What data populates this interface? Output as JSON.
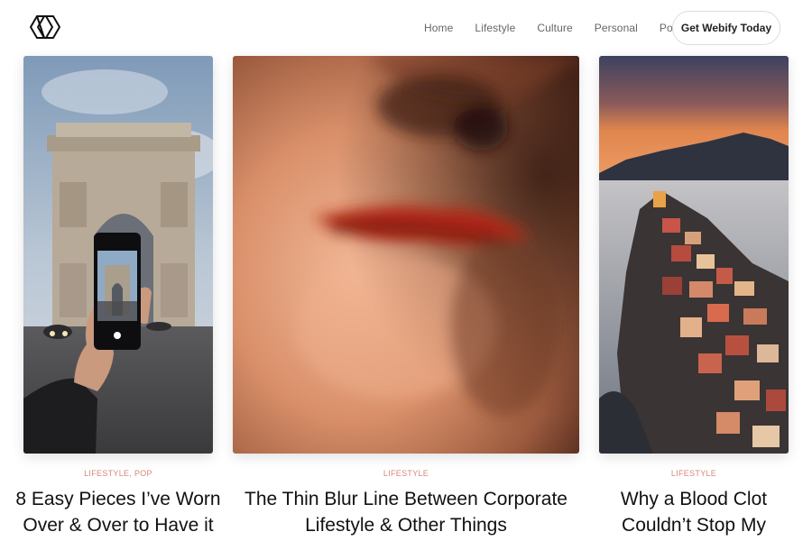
{
  "header": {
    "logo_name": "webify-logo",
    "nav": [
      {
        "label": "Home"
      },
      {
        "label": "Lifestyle"
      },
      {
        "label": "Culture"
      },
      {
        "label": "Personal"
      },
      {
        "label": "Pop"
      }
    ],
    "cta_label": "Get Webify Today"
  },
  "cards": [
    {
      "category": "LIFESTYLE, POP",
      "title_line1": "8 Easy Pieces I’ve Worn",
      "title_line2": "Over & Over to Have it",
      "image": "arc-de-triomphe-phone-photo"
    },
    {
      "category": "LIFESTYLE",
      "title_line1": "The Thin Blur Line Between Corporate",
      "title_line2": "Lifestyle & Other Things",
      "image": "blurred-face-red-lips"
    },
    {
      "category": "LIFESTYLE",
      "title_line1": "Why a Blood Clot",
      "title_line2": "Couldn’t Stop My",
      "image": "cinque-terre-coastal-village"
    }
  ],
  "colors": {
    "category": "#d9867a",
    "text": "#111111",
    "nav": "#666666"
  }
}
